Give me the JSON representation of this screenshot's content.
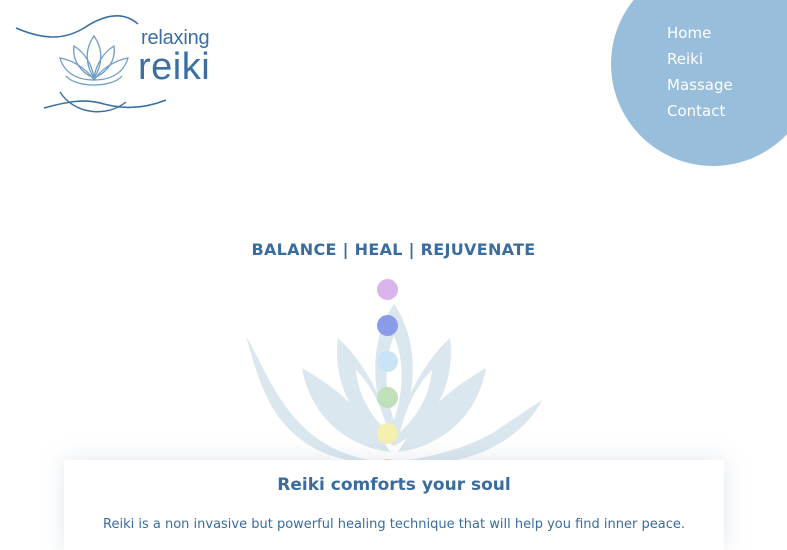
{
  "logo": {
    "line1": "relaxing",
    "line2": "reiki"
  },
  "nav": {
    "items": [
      {
        "label": "Home"
      },
      {
        "label": "Reiki"
      },
      {
        "label": "Massage"
      },
      {
        "label": "Contact"
      }
    ]
  },
  "hero": {
    "tagline": "BALANCE | HEAL | REJUVENATE",
    "chakra_colors": [
      "#dcb4ec",
      "#8a9be8",
      "#c8e4f6",
      "#bfe0b8",
      "#f6f0b0",
      "#f6cfae",
      "#f2b9ae"
    ]
  },
  "card": {
    "title": "Reiki comforts your soul",
    "text": "Reiki is a non invasive but powerful healing technique that will help you find inner peace."
  },
  "colors": {
    "brand": "#3a6c9e",
    "nav_circle": "#98bedc"
  }
}
